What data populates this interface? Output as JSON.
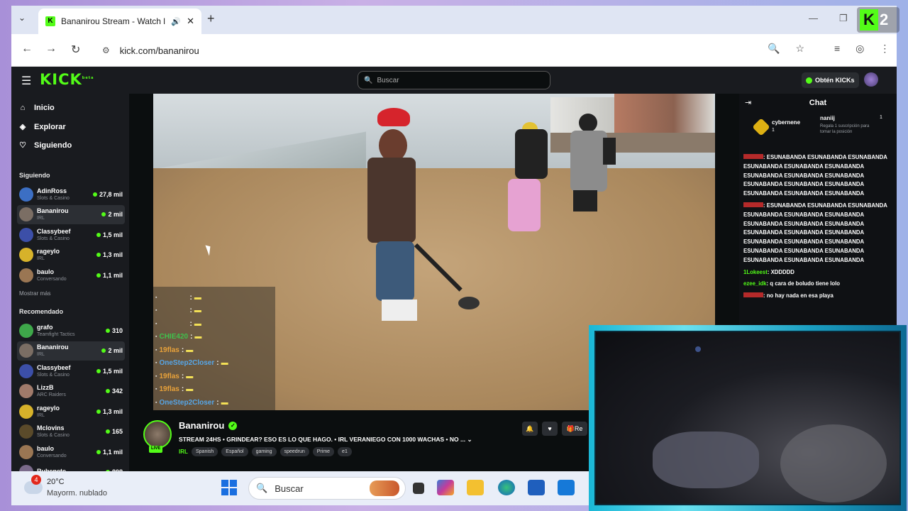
{
  "browser": {
    "tab_title": "Bananirou Stream - Watch l",
    "new_tab": "+",
    "url": "kick.com/bananirou",
    "overlay_logo_letter": "K",
    "overlay_logo_number": "2"
  },
  "kick": {
    "logo": "KICK",
    "logo_sup": "beta",
    "search_placeholder": "Buscar",
    "obtain_label": "Obtén KICKs",
    "nav": [
      {
        "label": "Inicio",
        "icon": "home-icon"
      },
      {
        "label": "Explorar",
        "icon": "compass-icon"
      },
      {
        "label": "Siguiendo",
        "icon": "heart-icon"
      }
    ],
    "following_title": "Siguiendo",
    "following": [
      {
        "name": "AdinRoss",
        "cat": "Slots & Casino",
        "viewers": "27,8 mil",
        "color": "#3c6fc4"
      },
      {
        "name": "Bananirou",
        "cat": "IRL",
        "viewers": "2 mil",
        "color": "#7b6e64"
      },
      {
        "name": "Classybeef",
        "cat": "Slots & Casino",
        "viewers": "1,5 mil",
        "color": "#3c4fa8"
      },
      {
        "name": "rageylo",
        "cat": "IRL",
        "viewers": "1,3 mil",
        "color": "#d7b22a"
      },
      {
        "name": "baulo",
        "cat": "Conversando",
        "viewers": "1,1 mil",
        "color": "#9a7653"
      }
    ],
    "show_more": "Mostrar más",
    "recommended_title": "Recomendado",
    "recommended": [
      {
        "name": "grafo",
        "cat": "Teamfight Tactics",
        "viewers": "310",
        "color": "#3ea84a"
      },
      {
        "name": "Bananirou",
        "cat": "IRL",
        "viewers": "2 mil",
        "color": "#7b6e64"
      },
      {
        "name": "Classybeef",
        "cat": "Slots & Casino",
        "viewers": "1,5 mil",
        "color": "#3c4fa8"
      },
      {
        "name": "LizzB",
        "cat": "ARC Raiders",
        "viewers": "342",
        "color": "#a07a6a"
      },
      {
        "name": "rageylo",
        "cat": "IRL",
        "viewers": "1,3 mil",
        "color": "#d7b22a"
      },
      {
        "name": "Mclovins",
        "cat": "Slots & Casino",
        "viewers": "165",
        "color": "#5a4a2a"
      },
      {
        "name": "baulo",
        "cat": "Conversando",
        "viewers": "1,1 mil",
        "color": "#9a7653"
      },
      {
        "name": "Rubenete",
        "cat": "",
        "viewers": "808",
        "color": "#7a6a8a"
      }
    ]
  },
  "overlay_chat": [
    {
      "user": "",
      "text": ":",
      "emote": true
    },
    {
      "user": "",
      "text": ":",
      "emote": true
    },
    {
      "user": "",
      "text": ":",
      "emote": true
    },
    {
      "user": "CHIE420",
      "text": ":",
      "emote": true
    },
    {
      "user": "19flas",
      "text": ":",
      "emote": true
    },
    {
      "user": "OneStep2Closer",
      "text": ":",
      "emote": true
    },
    {
      "user": "19flas",
      "text": ":",
      "emote": true
    },
    {
      "user": "19flas",
      "text": ":",
      "emote": true
    },
    {
      "user": "OneStep2Closer",
      "text": ":",
      "emote": true
    }
  ],
  "stream": {
    "name": "Bananirou",
    "live_badge": "LIVE",
    "title": "STREAM 24HS • GRINDEAR? ESO ES LO QUE HAGO. • IRL VERANIEGO CON 1000 WACHAS • NO ...",
    "category": "IRL",
    "tags": [
      "Spanish",
      "Español",
      "gaming",
      "speedrun",
      "Prime",
      "e1"
    ],
    "action_label": "Re"
  },
  "chat": {
    "title": "Chat",
    "pinned_user1": "cybernene",
    "pinned_num1": "1",
    "pinned_user2": "naniij",
    "pinned_num2": "1",
    "pinned_sub": "Regala 1 suscripción para tomar la posición",
    "messages": [
      {
        "user": "",
        "text": ": ESUNABANDA ESUNABANDA ESUNABANDA ESUNABANDA ESUNABANDA ESUNABANDA ESUNABANDA ESUNABANDA ESUNABANDA ESUNABANDA ESUNABANDA ESUNABANDA ESUNABANDA ESUNABANDA ESUNABANDA",
        "ucolor": "red"
      },
      {
        "user": "",
        "text": ": ESUNABANDA ESUNABANDA ESUNABANDA ESUNABANDA ESUNABANDA ESUNABANDA ESUNABANDA ESUNABANDA ESUNABANDA ESUNABANDA ESUNABANDA ESUNABANDA ESUNABANDA ESUNABANDA ESUNABANDA ESUNABANDA ESUNABANDA ESUNABANDA ESUNABANDA ESUNABANDA ESUNABANDA",
        "ucolor": "red"
      },
      {
        "user": "1Lokeest",
        "text": ": XDDDDD",
        "ucolor": "green"
      },
      {
        "user": "ezee_idk",
        "text": ": q cara de boludo tiene lolo",
        "ucolor": "green"
      },
      {
        "user": "",
        "text": ": no hay nada en esa playa",
        "ucolor": "red"
      }
    ]
  },
  "taskbar": {
    "weather_badge": "4",
    "temperature": "20°C",
    "weather_desc": "Mayorm. nublado",
    "search_label": "Buscar"
  }
}
